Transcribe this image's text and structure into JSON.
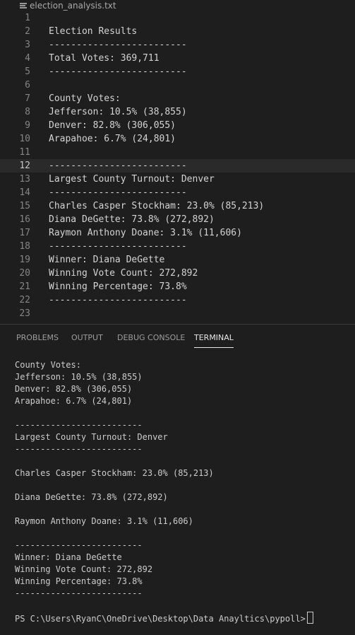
{
  "breadcrumb": {
    "filename": "election_analysis.txt",
    "icon": "text-file-icon"
  },
  "editor": {
    "current_line_index": 11,
    "lines": [
      {
        "num": "1",
        "text": ""
      },
      {
        "num": "2",
        "text": "Election Results"
      },
      {
        "num": "3",
        "text": "-------------------------"
      },
      {
        "num": "4",
        "text": "Total Votes: 369,711"
      },
      {
        "num": "5",
        "text": "-------------------------"
      },
      {
        "num": "6",
        "text": ""
      },
      {
        "num": "7",
        "text": "County Votes:"
      },
      {
        "num": "8",
        "text": "Jefferson: 10.5% (38,855)"
      },
      {
        "num": "9",
        "text": "Denver: 82.8% (306,055)"
      },
      {
        "num": "10",
        "text": "Arapahoe: 6.7% (24,801)"
      },
      {
        "num": "11",
        "text": ""
      },
      {
        "num": "12",
        "text": "-------------------------"
      },
      {
        "num": "13",
        "text": "Largest County Turnout: Denver"
      },
      {
        "num": "14",
        "text": "-------------------------"
      },
      {
        "num": "15",
        "text": "Charles Casper Stockham: 23.0% (85,213)"
      },
      {
        "num": "16",
        "text": "Diana DeGette: 73.8% (272,892)"
      },
      {
        "num": "17",
        "text": "Raymon Anthony Doane: 3.1% (11,606)"
      },
      {
        "num": "18",
        "text": "-------------------------"
      },
      {
        "num": "19",
        "text": "Winner: Diana DeGette"
      },
      {
        "num": "20",
        "text": "Winning Vote Count: 272,892"
      },
      {
        "num": "21",
        "text": "Winning Percentage: 73.8%"
      },
      {
        "num": "22",
        "text": "-------------------------"
      },
      {
        "num": "23",
        "text": ""
      }
    ]
  },
  "panel": {
    "tabs": [
      {
        "label": "PROBLEMS",
        "active": false
      },
      {
        "label": "OUTPUT",
        "active": false
      },
      {
        "label": "DEBUG CONSOLE",
        "active": false
      },
      {
        "label": "TERMINAL",
        "active": true
      }
    ]
  },
  "terminal": {
    "lines": [
      "County Votes:",
      "Jefferson: 10.5% (38,855)",
      "Denver: 82.8% (306,055)",
      "Arapahoe: 6.7% (24,801)",
      "",
      "-------------------------",
      "Largest County Turnout: Denver",
      "-------------------------",
      "",
      "Charles Casper Stockham: 23.0% (85,213)",
      "",
      "Diana DeGette: 73.8% (272,892)",
      "",
      "Raymon Anthony Doane: 3.1% (11,606)",
      "",
      "-------------------------",
      "Winner: Diana DeGette",
      "Winning Vote Count: 272,892",
      "Winning Percentage: 73.8%",
      "-------------------------",
      "",
      "PS C:\\Users\\RyanC\\OneDrive\\Desktop\\Data Anayltics\\pypoll>"
    ]
  },
  "colors": {
    "background": "#1e1e1e",
    "text": "#d4d4d4",
    "line_number": "#858585",
    "current_line": "#2a2a2a",
    "terminal_text": "#cccccc"
  }
}
